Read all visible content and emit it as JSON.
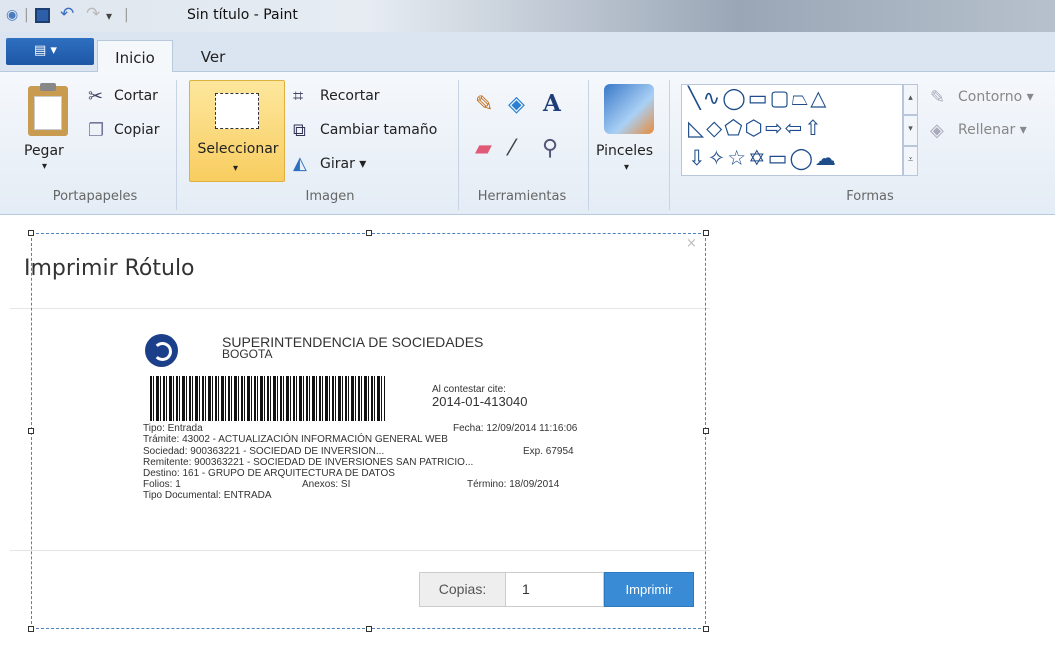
{
  "window": {
    "title": "Sin título - Paint"
  },
  "quick_access": {
    "sep": "|",
    "undo_icon": "↶",
    "redo_icon": "↷",
    "menu_icon": "▾"
  },
  "tabs": {
    "file_icon": "▤ ▾",
    "inicio": "Inicio",
    "ver": "Ver"
  },
  "ribbon": {
    "portapapeles": {
      "group": "Portapapeles",
      "pegar": "Pegar",
      "cortar": "Cortar",
      "copiar": "Copiar",
      "dropdown": "▾"
    },
    "imagen": {
      "group": "Imagen",
      "seleccionar": "Seleccionar",
      "recortar": "Recortar",
      "cambiar_tamano": "Cambiar tamaño",
      "girar": "Girar ▾",
      "dropdown": "▾"
    },
    "herramientas": {
      "group": "Herramientas",
      "text_tool": "A"
    },
    "pinceles": {
      "label": "Pinceles",
      "dropdown": "▾"
    },
    "formas": {
      "group": "Formas",
      "contorno": "Contorno ▾",
      "rellenar": "Rellenar ▾",
      "row1": "╲∿◯▭▢⏢△",
      "row2": "◺◇⬠⬡⇨⇦⇧",
      "row3": "⇩✧☆✡▭◯☁",
      "scroll_up": "▴",
      "scroll_down": "▾",
      "scroll_more": "⩡"
    }
  },
  "dialog": {
    "title": "Imprimir Rótulo",
    "close": "×",
    "label": {
      "org": "SUPERINTENDENCIA DE SOCIEDADES",
      "city": "BOGOTA",
      "cite_label": "Al contestar cite:",
      "cite_number": "2014-01-413040",
      "tipo": "Tipo: Entrada",
      "fecha": "Fecha: 12/09/2014 11:16:06",
      "tramite": "Trámite: 43002 - ACTUALIZACIÓN INFORMACIÓN GENERAL WEB",
      "sociedad": "Sociedad: 900363221 - SOCIEDAD DE INVERSION...",
      "exp": "Exp. 67954",
      "remitente": "Remitente: 900363221 - SOCIEDAD DE INVERSIONES SAN PATRICIO...",
      "destino": "Destino: 161 - GRUPO DE ARQUITECTURA DE DATOS",
      "folios": "Folios: 1",
      "anexos": "Anexos: SI",
      "termino": "Término: 18/09/2014",
      "tipo_documental": "Tipo Documental: ENTRADA"
    },
    "copias_label": "Copias:",
    "copias_value": "1",
    "imprimir": "Imprimir"
  }
}
